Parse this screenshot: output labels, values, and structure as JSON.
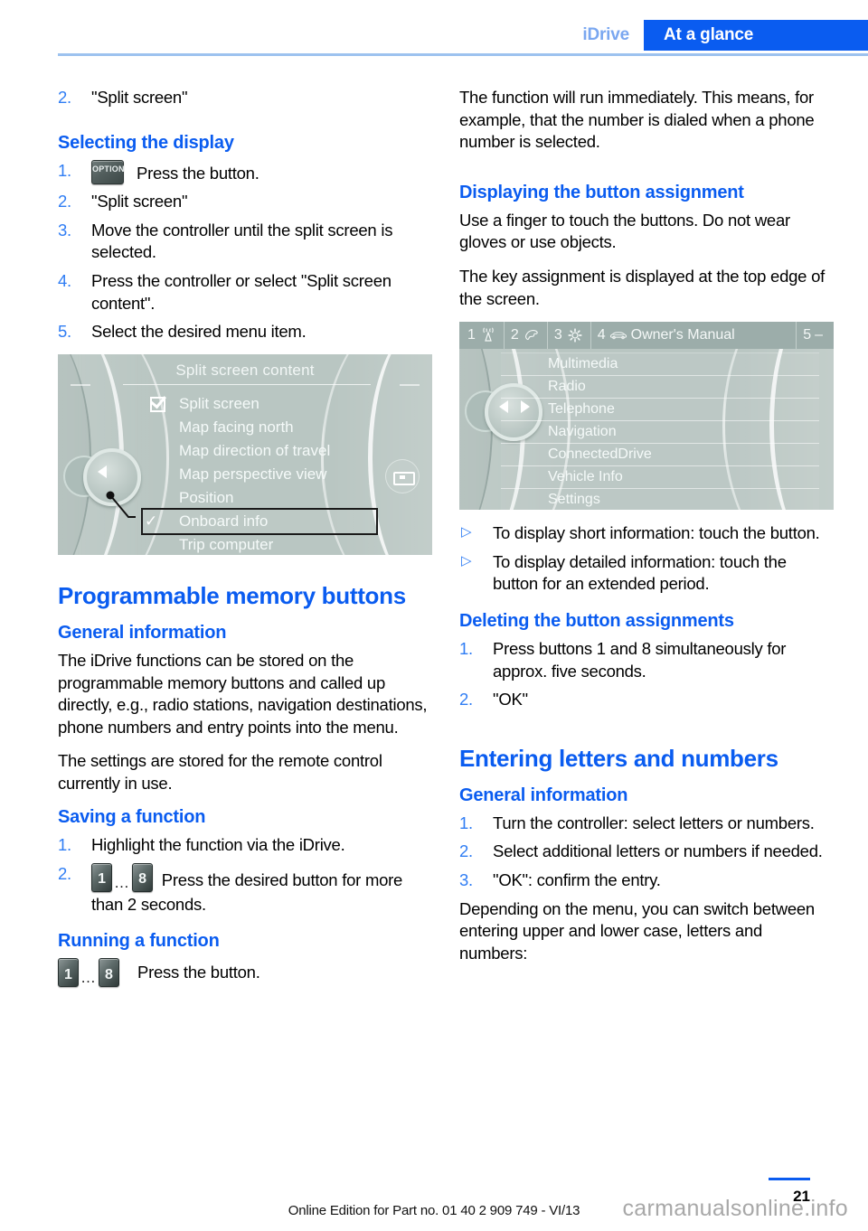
{
  "header": {
    "breadcrumb_section": "iDrive",
    "breadcrumb_chapter": "At a glance",
    "accent_color": "#0a5cf0",
    "muted_accent_color": "#7aa7f0"
  },
  "left_column": {
    "intro_item": {
      "marker": "2.",
      "text": "\"Split screen\""
    },
    "selecting_display": {
      "title": "Selecting the display",
      "steps": [
        {
          "marker": "1.",
          "icon": "option-button-icon",
          "icon_label": "OPTION",
          "text": "Press the button."
        },
        {
          "marker": "2.",
          "text": "\"Split screen\""
        },
        {
          "marker": "3.",
          "text": "Move the controller until the split screen is selected."
        },
        {
          "marker": "4.",
          "text": "Press the controller or select \"Split screen content\"."
        },
        {
          "marker": "5.",
          "text": "Select the desired menu item."
        }
      ]
    },
    "split_screen_figure": {
      "title": "Split screen content",
      "items": [
        {
          "label": "Split screen",
          "mark": "checkbox"
        },
        {
          "label": "Map facing north",
          "mark": "none"
        },
        {
          "label": "Map direction of travel",
          "mark": "none"
        },
        {
          "label": "Map perspective view",
          "mark": "none"
        },
        {
          "label": "Position",
          "mark": "none"
        },
        {
          "label": "Onboard info",
          "mark": "check",
          "selected": true
        },
        {
          "label": "Trip computer",
          "mark": "none"
        }
      ]
    },
    "programmable_memory": {
      "title": "Programmable memory buttons",
      "general_information_title": "General information",
      "paragraphs": [
        "The iDrive functions can be stored on the programmable memory buttons and called up directly, e.g., radio stations, navigation destinations, phone numbers and entry points into the menu.",
        "The settings are stored for the remote control currently in use."
      ],
      "saving_title": "Saving a function",
      "saving_steps": [
        {
          "marker": "1.",
          "text": "Highlight the function via the iDrive."
        },
        {
          "marker": "2.",
          "button_from": "1",
          "button_ellipsis": "…",
          "button_to": "8",
          "text": "Press the desired button for more than 2 seconds."
        }
      ],
      "running_title": "Running a function",
      "running": {
        "button_from": "1",
        "button_ellipsis": "…",
        "button_to": "8",
        "text": "Press the button."
      }
    }
  },
  "right_column": {
    "intro_paragraph": "The function will run immediately. This means, for example, that the number is dialed when a phone number is selected.",
    "displaying_assignment": {
      "title": "Displaying the button assignment",
      "paragraphs": [
        "Use a finger to touch the buttons. Do not wear gloves or use objects.",
        "The key assignment is displayed at the top edge of the screen."
      ]
    },
    "manual_figure": {
      "topbar": [
        {
          "number": "1",
          "icon": "antenna-icon"
        },
        {
          "number": "2",
          "icon": "telephone-icon"
        },
        {
          "number": "3",
          "icon": "gear-icon"
        },
        {
          "number": "4",
          "icon": "car-icon",
          "label": "Owner's Manual"
        },
        {
          "number": "5",
          "icon": "dash-icon"
        }
      ],
      "items": [
        "Multimedia",
        "Radio",
        "Telephone",
        "Navigation",
        "ConnectedDrive",
        "Vehicle Info",
        "Settings"
      ]
    },
    "touch_bullets": [
      {
        "marker": "▷",
        "text": "To display short information: touch the button."
      },
      {
        "marker": "▷",
        "text": "To display detailed information: touch the button for an extended period."
      }
    ],
    "deleting_assignments": {
      "title": "Deleting the button assignments",
      "steps": [
        {
          "marker": "1.",
          "text": "Press buttons 1 and 8 simultaneously for approx. five seconds."
        },
        {
          "marker": "2.",
          "text": "\"OK\""
        }
      ]
    },
    "entering_letters": {
      "title": "Entering letters and numbers",
      "general_information_title": "General information",
      "steps": [
        {
          "marker": "1.",
          "text": "Turn the controller: select letters or numbers."
        },
        {
          "marker": "2.",
          "text": "Select additional letters or numbers if needed."
        },
        {
          "marker": "3.",
          "text": "\"OK\": confirm the entry."
        }
      ],
      "closing_paragraph": "Depending on the menu, you can switch between entering upper and lower case, letters and numbers:"
    }
  },
  "footer": {
    "online_edition": "Online Edition for Part no. 01 40 2 909 749 - VI/13",
    "page_number": "21",
    "watermark": "carmanualsonline.info"
  }
}
